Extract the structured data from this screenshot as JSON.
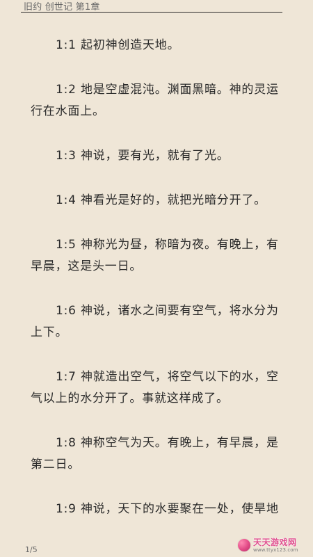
{
  "header": {
    "title": "旧约 创世记 第1章"
  },
  "verses": [
    {
      "num": "1:1",
      "text": "起初神创造天地。"
    },
    {
      "num": "1:2",
      "text": "地是空虚混沌。渊面黑暗。神的灵运行在水面上。"
    },
    {
      "num": "1:3",
      "text": "神说，要有光，就有了光。"
    },
    {
      "num": "1:4",
      "text": "神看光是好的，就把光暗分开了。"
    },
    {
      "num": "1:5",
      "text": "神称光为昼，称暗为夜。有晚上，有早晨，这是头一日。"
    },
    {
      "num": "1:6",
      "text": "神说，诸水之间要有空气，将水分为上下。"
    },
    {
      "num": "1:7",
      "text": "神就造出空气，将空气以下的水，空气以上的水分开了。事就这样成了。"
    },
    {
      "num": "1:8",
      "text": "神称空气为天。有晚上，有早晨，是第二日。"
    },
    {
      "num": "1:9",
      "text": "神说，天下的水要聚在一处，使旱地"
    }
  ],
  "footer": {
    "page": "1/5"
  },
  "watermark": {
    "title": "天天游戏网",
    "subtitle": "www.ttyx123.com"
  }
}
